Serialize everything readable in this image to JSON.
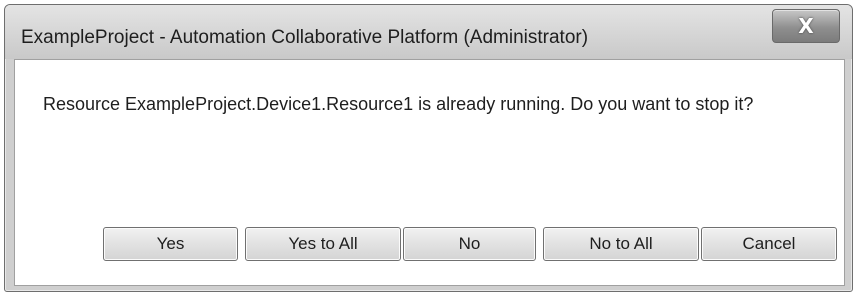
{
  "window": {
    "title": "ExampleProject - Automation Collaborative Platform (Administrator)",
    "close_icon": "close-icon",
    "close_glyph": "X"
  },
  "dialog": {
    "message": "Resource ExampleProject.Device1.Resource1 is already running. Do you want to stop it?"
  },
  "buttons": {
    "yes": "Yes",
    "yes_to_all": "Yes to All",
    "no": "No",
    "no_to_all": "No to All",
    "cancel": "Cancel"
  }
}
